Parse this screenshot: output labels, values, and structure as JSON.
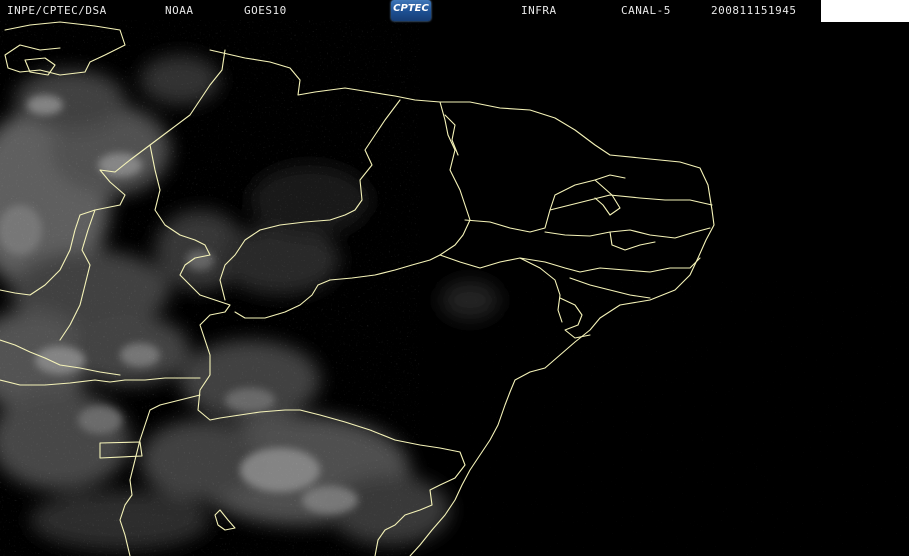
{
  "header": {
    "institution": "INPE/CPTEC/DSA",
    "agency": "NOAA",
    "satellite": "GOES10",
    "logo_text": "CPTEC",
    "product": "INFRA",
    "channel": "CANAL-5",
    "timestamp": "200811151945"
  },
  "colors": {
    "background": "#000000",
    "borders": "#f5f3b8",
    "header_text": "#e8e8e8",
    "logo_blue": "#2a5fa8"
  },
  "layers": {
    "imagery": "infrared-satellite-clouds",
    "overlay": "state-and-country-boundaries"
  }
}
